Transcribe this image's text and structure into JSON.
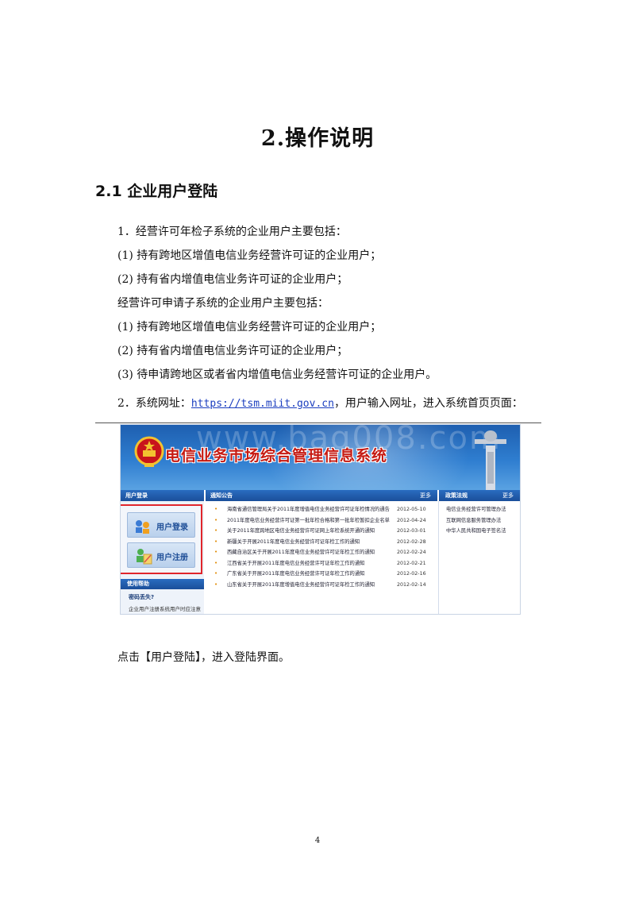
{
  "doc": {
    "title": "2.操作说明",
    "section": "2.1 企业用户登陆",
    "paragraphs": [
      "1．经营许可年检子系统的企业用户主要包括：",
      "(1)  持有跨地区增值电信业务经营许可证的企业用户；",
      "(2)  持有省内增值电信业务许可证的企业用户；",
      "经营许可申请子系统的企业用户主要包括：",
      "(1)  持有跨地区增值电信业务经营许可证的企业用户；",
      "(2)  持有省内增值电信业务许可证的企业用户；",
      "(3)  待申请跨地区或者省内增值电信业务经营许可证的企业用户。"
    ],
    "url_line": {
      "prefix": "2．系统网址：",
      "url": "https://tsm.miit.gov.cn",
      "suffix": "，用户输入网址，进入系统首页页面："
    },
    "after_text": "点击【用户登陆】，进入登陆界面。",
    "page_number": "4"
  },
  "screenshot": {
    "watermark": "www.bag008.com",
    "system_title": "电信业务市场综合管理信息系统",
    "login_bar": "用户登录",
    "notice_bar": "通知公告",
    "notice_more": "更多",
    "policy_bar": "政策法规",
    "policy_more": "更多",
    "login_button": "用户登录",
    "register_button": "用户注册",
    "help_bar": "使用帮助",
    "help_question": "密码丢失?",
    "help_answer": "企业用户注册系统用户时应注意",
    "notices": [
      {
        "title": "海南省通信管理局关于2011年度增值电信业务经营许可证年检情况的通告",
        "date": "2012-05-10"
      },
      {
        "title": "2011年度电信业务经营许可证第一批年检合格和第一批年检暂扣企业名单",
        "date": "2012-04-24"
      },
      {
        "title": "关于2011年度跨地区电信业务经营许可证网上年检系统开通的通知",
        "date": "2012-03-01"
      },
      {
        "title": "新疆关于开展2011年度电信业务经营许可证年检工作的通知",
        "date": "2012-02-28"
      },
      {
        "title": "西藏自治区关于开展2011年度电信业务经营许可证年检工作的通知",
        "date": "2012-02-24"
      },
      {
        "title": "江西省关于开展2011年度电信业务经营许可证年检工作的通知",
        "date": "2012-02-21"
      },
      {
        "title": "广东省关于开展2011年度电信业务经营许可证年检工作的通知",
        "date": "2012-02-16"
      },
      {
        "title": "山东省关于开展2011年度增值电信业务经营许可证年检工作的通知",
        "date": "2012-02-14"
      }
    ],
    "policies": [
      "电信业务经营许可管理办法",
      "互联网信息服务管理办法",
      "中华人民共和国电子签名法"
    ],
    "colors": {
      "banner": "#2f7ed0",
      "title_red": "#c61a12",
      "highlight_border": "#e0262c"
    }
  }
}
